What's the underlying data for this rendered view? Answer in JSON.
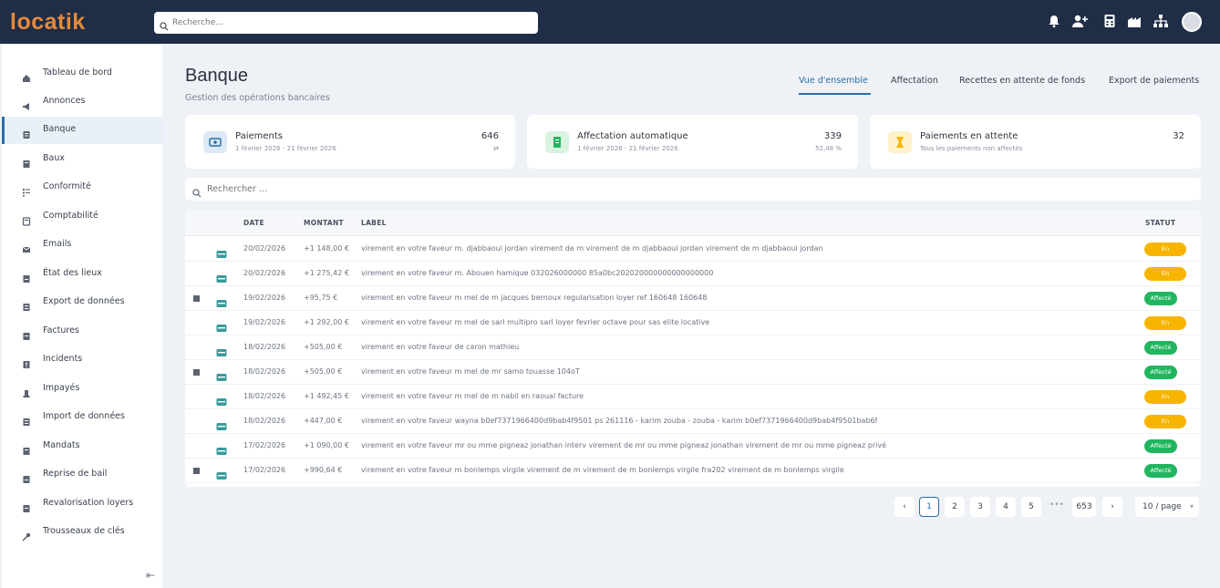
{
  "app": {
    "logo": "locatik"
  },
  "topbar": {
    "search_placeholder": "Recherche...",
    "icons": [
      "bell-icon",
      "user-add-icon",
      "calculator-icon",
      "building-icon",
      "org-chart-icon"
    ]
  },
  "sidebar": {
    "items": [
      {
        "label": "Tableau de bord",
        "icon": "home-icon"
      },
      {
        "label": "Annonces",
        "icon": "megaphone-icon"
      },
      {
        "label": "Banque",
        "icon": "bank-icon",
        "active": true
      },
      {
        "label": "Baux",
        "icon": "lease-icon"
      },
      {
        "label": "Conformité",
        "icon": "checklist-icon"
      },
      {
        "label": "Comptabilité",
        "icon": "accounting-icon"
      },
      {
        "label": "Emails",
        "icon": "mail-icon"
      },
      {
        "label": "État des lieux",
        "icon": "inspection-icon"
      },
      {
        "label": "Export de données",
        "icon": "export-icon"
      },
      {
        "label": "Factures",
        "icon": "invoice-icon"
      },
      {
        "label": "Incidents",
        "icon": "incident-icon"
      },
      {
        "label": "Impayés",
        "icon": "unpaid-icon"
      },
      {
        "label": "Import de données",
        "icon": "import-icon"
      },
      {
        "label": "Mandats",
        "icon": "mandate-icon"
      },
      {
        "label": "Reprise de bail",
        "icon": "takeover-icon"
      },
      {
        "label": "Revalorisation loyers",
        "icon": "revaluation-icon"
      },
      {
        "label": "Trousseaux de clés",
        "icon": "key-icon"
      }
    ],
    "collapse_label": "⇤"
  },
  "main": {
    "title": "Banque",
    "subtitle": "Gestion des opérations bancaires",
    "tabs": [
      {
        "label": "Vue d'ensemble",
        "active": true
      },
      {
        "label": "Affectation"
      },
      {
        "label": "Recettes en attente de fonds"
      },
      {
        "label": "Export de paiements"
      }
    ]
  },
  "cards": [
    {
      "title": "Paiements",
      "subtitle": "1 février 2026 - 21 février 2026",
      "value": "646",
      "value2": "⇄",
      "icon_color": "#dde9f6",
      "icon_fg": "#2a6fa8"
    },
    {
      "title": "Affectation automatique",
      "subtitle": "1 février 2026 - 21 février 2026",
      "value": "339",
      "value2": "52,48 %",
      "icon_color": "#d9f3df",
      "icon_fg": "#22b55f"
    },
    {
      "title": "Paiements en attente",
      "subtitle": "Tous les paiements non affectés",
      "value": "32",
      "value2": "",
      "icon_color": "#fff1c9",
      "icon_fg": "#f7b500"
    }
  ],
  "filter": {
    "placeholder": "Rechercher ..."
  },
  "table": {
    "headers": {
      "date": "DATE",
      "montant": "MONTANT",
      "label": "LABEL",
      "statut": "STATUT"
    },
    "rows": [
      {
        "mark": false,
        "date": "20/02/2026",
        "montant": "+1 148,00 €",
        "label": "virement en votre faveur m. djabbaoui jordan virement de m virement de m djabbaoui jordan virement de m djabbaoui jordan",
        "status": "En attente",
        "status_kind": "pending"
      },
      {
        "mark": false,
        "date": "20/02/2026",
        "montant": "+1 275,42 €",
        "label": "virement en votre faveur m. Abouen hamique 032026000000 85a0bc202020000000000000000",
        "status": "En attente",
        "status_kind": "pending"
      },
      {
        "mark": true,
        "date": "19/02/2026",
        "montant": "+95,75 €",
        "label": "virement en votre faveur m mel de m jacques bernoux regularisation loyer ref 160648 160648",
        "status": "Affecté",
        "status_kind": "done"
      },
      {
        "mark": false,
        "date": "19/02/2026",
        "montant": "+1 292,00 €",
        "label": "virement en votre faveur m mel de sarl multipro sarl loyer fevrier octave pour sas elite locative",
        "status": "En attente",
        "status_kind": "pending"
      },
      {
        "mark": false,
        "date": "18/02/2026",
        "montant": "+505,00 €",
        "label": "virement en votre faveur de caron mathieu",
        "status": "Affecté",
        "status_kind": "done"
      },
      {
        "mark": true,
        "date": "18/02/2026",
        "montant": "+505,00 €",
        "label": "virement en votre faveur m mel de mr samo touasse 104oT",
        "status": "Affecté",
        "status_kind": "done"
      },
      {
        "mark": false,
        "date": "18/02/2026",
        "montant": "+1 492,45 €",
        "label": "virement en votre faveur m mel de m nabil en raoual facture",
        "status": "En attente",
        "status_kind": "pending"
      },
      {
        "mark": false,
        "date": "18/02/2026",
        "montant": "+447,00 €",
        "label": "virement en votre faveur wayna b0ef7371966400d9bab4f9501 ps 261116 - karim zouba - zouba - karim b0ef7371966400d9bab4f9501bab6f",
        "status": "En attente",
        "status_kind": "pending"
      },
      {
        "mark": false,
        "date": "17/02/2026",
        "montant": "+1 090,00 €",
        "label": "virement en votre faveur mr ou mme pigneaz jonathan interv virement de mr ou mme pigneaz jonathan virement de mr ou mme pigneaz privé",
        "status": "Affecté",
        "status_kind": "done"
      },
      {
        "mark": true,
        "date": "17/02/2026",
        "montant": "+990,64 €",
        "label": "virement en votre faveur m bonlemps virgile virement de m virement de m bonlemps virgile fra202 virement de m bonlemps virgile",
        "status": "Affecté",
        "status_kind": "done"
      }
    ]
  },
  "pagination": {
    "prev": "‹",
    "pages": [
      "1",
      "2",
      "3",
      "4",
      "5"
    ],
    "dots": "•••",
    "last": "653",
    "next": "›",
    "page_size": "10 / page"
  }
}
